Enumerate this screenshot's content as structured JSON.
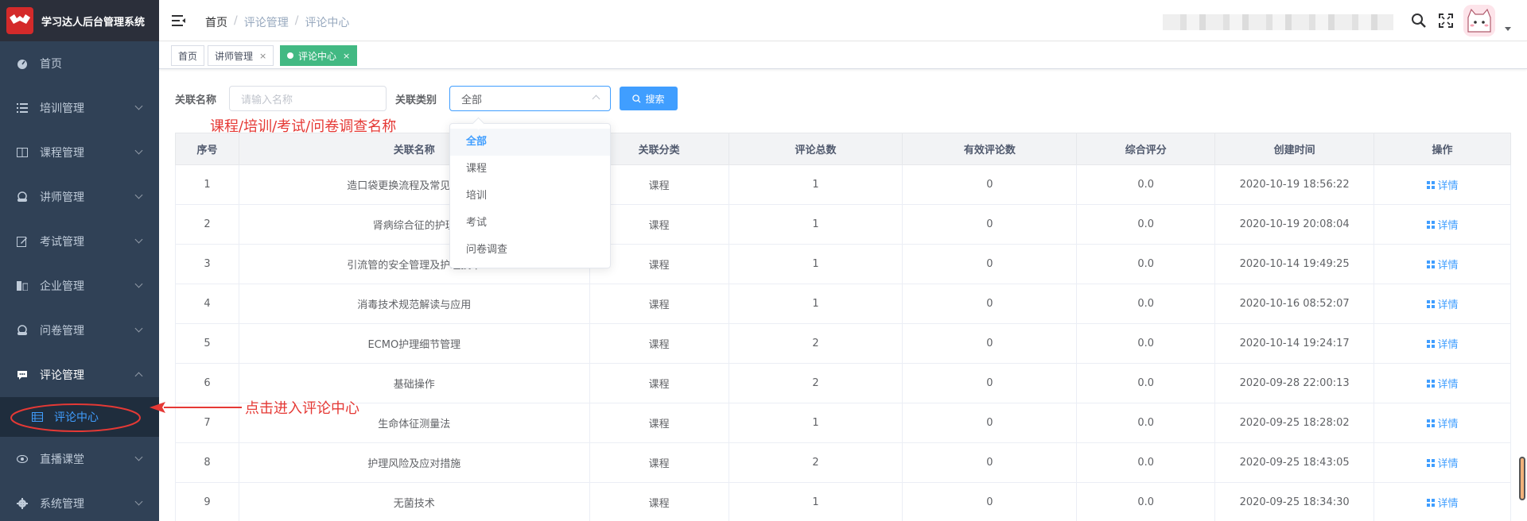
{
  "app": {
    "title": "学习达人后台管理系统"
  },
  "sidebar": {
    "items": [
      {
        "label": "首页",
        "icon": "dashboard-icon"
      },
      {
        "label": "培训管理",
        "icon": "list-icon"
      },
      {
        "label": "课程管理",
        "icon": "book-icon"
      },
      {
        "label": "讲师管理",
        "icon": "people-icon"
      },
      {
        "label": "考试管理",
        "icon": "edit-icon"
      },
      {
        "label": "企业管理",
        "icon": "building-icon"
      },
      {
        "label": "问卷管理",
        "icon": "survey-icon"
      },
      {
        "label": "评论管理",
        "icon": "comment-icon"
      },
      {
        "label": "直播课堂",
        "icon": "eye-icon"
      },
      {
        "label": "系统管理",
        "icon": "gear-icon"
      }
    ],
    "submenu_active": "评论中心"
  },
  "navbar": {
    "breadcrumb": [
      "首页",
      "评论管理",
      "评论中心"
    ],
    "separator": "/"
  },
  "tags": [
    {
      "label": "首页"
    },
    {
      "label": "讲师管理",
      "close": "×"
    },
    {
      "label": "评论中心",
      "close": "×",
      "active": true
    }
  ],
  "search": {
    "name_label": "关联名称",
    "name_placeholder": "请输入名称",
    "type_label": "关联类别",
    "type_value": "全部",
    "button": "搜索"
  },
  "dropdown": {
    "options": [
      "全部",
      "课程",
      "培训",
      "考试",
      "问卷调查"
    ],
    "selected": "全部"
  },
  "annotations": {
    "name_hint": "课程/培训/考试/问卷调查名称",
    "click_hint": "点击进入评论中心"
  },
  "table": {
    "headers": [
      "序号",
      "关联名称",
      "关联分类",
      "评论总数",
      "有效评论数",
      "综合评分",
      "创建时间",
      "操作"
    ],
    "action_label": "详情",
    "rows": [
      [
        "1",
        "造口袋更换流程及常见并发症",
        "课程",
        "1",
        "0",
        "0.0",
        "2020-10-19 18:56:22"
      ],
      [
        "2",
        "肾病综合征的护理",
        "课程",
        "1",
        "0",
        "0.0",
        "2020-10-19 20:08:04"
      ],
      [
        "3",
        "引流管的安全管理及护理技术",
        "课程",
        "1",
        "0",
        "0.0",
        "2020-10-14 19:49:25"
      ],
      [
        "4",
        "消毒技术规范解读与应用",
        "课程",
        "1",
        "0",
        "0.0",
        "2020-10-16 08:52:07"
      ],
      [
        "5",
        "ECMO护理细节管理",
        "课程",
        "2",
        "0",
        "0.0",
        "2020-10-14 19:24:17"
      ],
      [
        "6",
        "基础操作",
        "课程",
        "2",
        "0",
        "0.0",
        "2020-09-28 22:00:13"
      ],
      [
        "7",
        "生命体征测量法",
        "课程",
        "1",
        "0",
        "0.0",
        "2020-09-25 18:28:02"
      ],
      [
        "8",
        "护理风险及应对措施",
        "课程",
        "2",
        "0",
        "0.0",
        "2020-09-25 18:43:05"
      ],
      [
        "9",
        "无菌技术",
        "课程",
        "1",
        "0",
        "0.0",
        "2020-09-25 18:34:30"
      ]
    ]
  },
  "colors": {
    "primary": "#409eff",
    "sidebar": "#304156",
    "tag_active": "#42b983",
    "annotation": "#e53935"
  }
}
